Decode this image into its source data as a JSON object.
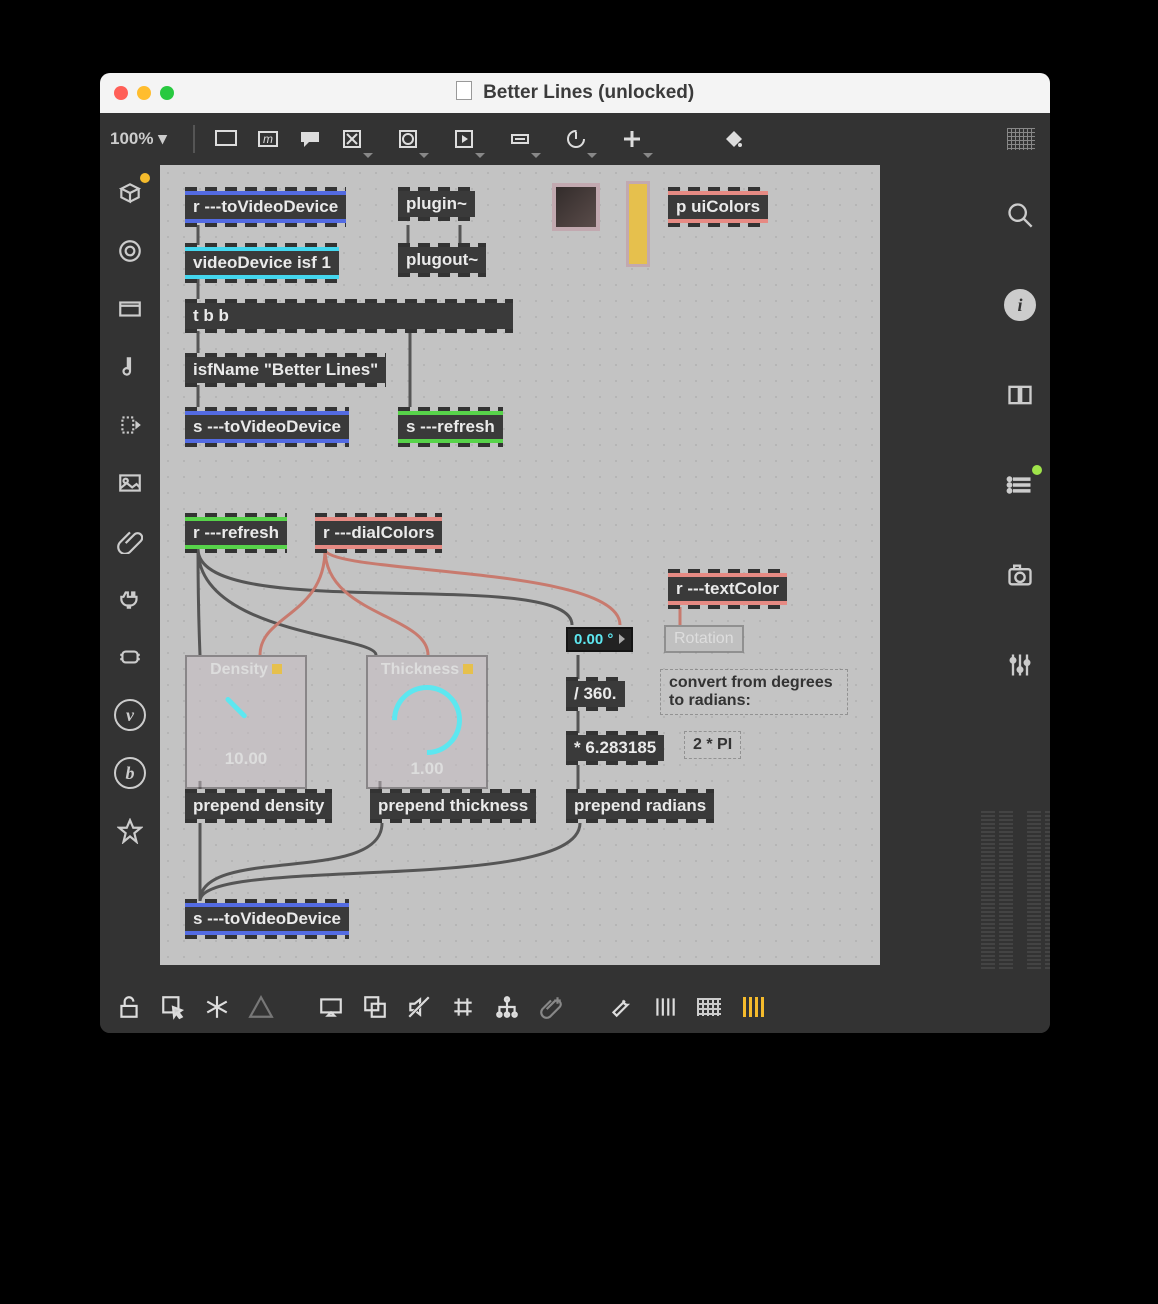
{
  "window": {
    "title": "Better Lines (unlocked)"
  },
  "toolbar": {
    "zoom": "100% ▾"
  },
  "objects": {
    "r_toVideoDevice": "r ---toVideoDevice",
    "videoDevice_isf": "videoDevice isf 1",
    "tbb": "t b b",
    "isfName": "isfName \"Better Lines\"",
    "s_toVideoDevice": "s ---toVideoDevice",
    "plugin": "plugin~",
    "plugout": "plugout~",
    "p_uiColors": "p uiColors",
    "r_refresh": "r ---refresh",
    "s_refresh": "s ---refresh",
    "r_dialColors": "r ---dialColors",
    "r_textColor": "r ---textColor",
    "prepend_density": "prepend density",
    "prepend_thickness": "prepend thickness",
    "prepend_radians": "prepend radians",
    "div360": "/ 360.",
    "mul2pi": "* 6.283185",
    "s_toVideoDevice2": "s ---toVideoDevice"
  },
  "panels": {
    "density": {
      "title": "Density",
      "value": "10.00"
    },
    "thickness": {
      "title": "Thickness",
      "value": "1.00"
    },
    "rotation": {
      "num": "0.00 °",
      "label": "Rotation"
    }
  },
  "comments": {
    "convert": "convert from degrees to radians:",
    "two_pi": "2 * PI"
  }
}
